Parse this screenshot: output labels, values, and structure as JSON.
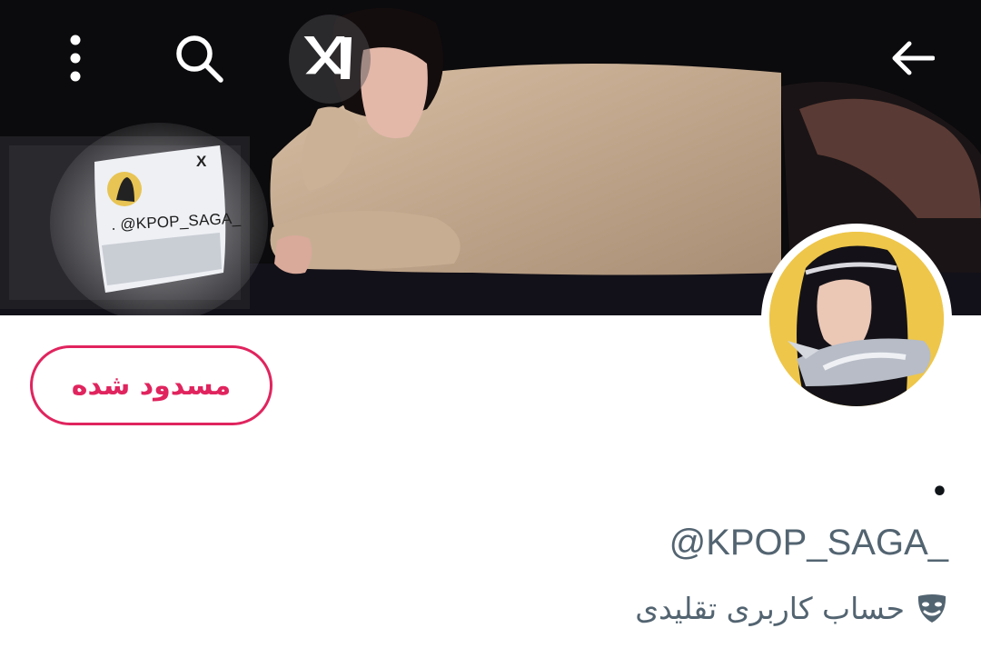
{
  "header": {
    "back_icon": "arrow-left-icon",
    "more_icon": "more-vertical-icon",
    "search_icon": "search-icon",
    "badge_icon": "x1-logo-icon"
  },
  "banner": {
    "tv_screen_handle": ". @KPOP_SAGA_",
    "tv_screen_logo": "X"
  },
  "profile": {
    "display_name": "•",
    "handle": "@KPOP_SAGA_",
    "parody_label": "حساب کاربری تقلیدی",
    "parody_icon": "theater-mask-icon"
  },
  "actions": {
    "blocked_label": "مسدود شده"
  },
  "colors": {
    "blocked_red": "#e0245e",
    "secondary_text": "#536471",
    "primary_text": "#0f1419",
    "avatar_bg": "#eec64a"
  }
}
